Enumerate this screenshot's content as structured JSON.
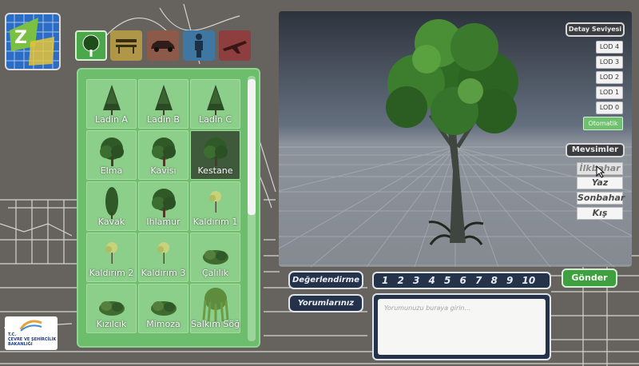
{
  "categories": [
    {
      "icon": "tree-icon",
      "active": true
    },
    {
      "icon": "bench-icon",
      "active": false
    },
    {
      "icon": "car-icon",
      "active": false
    },
    {
      "icon": "person-icon",
      "active": false
    },
    {
      "icon": "plane-icon",
      "active": false
    }
  ],
  "plants": [
    {
      "label": "Ladin A",
      "icon": "conifer-icon"
    },
    {
      "label": "Ladin B",
      "icon": "conifer-icon"
    },
    {
      "label": "Ladin C",
      "icon": "conifer-icon"
    },
    {
      "label": "Elma",
      "icon": "tree-icon"
    },
    {
      "label": "Kavisı",
      "icon": "tree-icon"
    },
    {
      "label": "Kestane",
      "icon": "tree-icon",
      "selected": true
    },
    {
      "label": "Kavak",
      "icon": "poplar-icon"
    },
    {
      "label": "Ihlamur",
      "icon": "tree-icon"
    },
    {
      "label": "Kaldırım 1",
      "icon": "sapling-icon"
    },
    {
      "label": "Kaldırım 2",
      "icon": "sapling-icon"
    },
    {
      "label": "Kaldırım 3",
      "icon": "sapling-icon"
    },
    {
      "label": "Çalılık",
      "icon": "shrub-icon"
    },
    {
      "label": "Kızılcık",
      "icon": "shrub-icon"
    },
    {
      "label": "Mimoza",
      "icon": "shrub-icon"
    },
    {
      "label": "Salkım Söğ",
      "icon": "willow-icon"
    }
  ],
  "ministry": {
    "line1": "T.C.",
    "line2": "ÇEVRE VE ŞEHİRCİLİK",
    "line3": "BAKANLIĞI"
  },
  "detail": {
    "title": "Detay Seviyesi",
    "levels": [
      "LOD 4",
      "LOD 3",
      "LOD 2",
      "LOD 1",
      "LOD 0"
    ],
    "auto": "Otomatik"
  },
  "seasons": {
    "title": "Mevsimler",
    "items": [
      "İlkbahar",
      "Yaz",
      "Sonbahar",
      "Kış"
    ]
  },
  "feedback": {
    "rating_label": "Değerlendirme",
    "comments_label": "Yorumlarınız",
    "ratings": [
      "1",
      "2",
      "3",
      "4",
      "5",
      "6",
      "7",
      "8",
      "9",
      "10"
    ],
    "send": "Gönder",
    "placeholder": "Yorumunuzu buraya girin..."
  },
  "colors": {
    "panel": "#6cbd6c",
    "accent": "#3fa03f",
    "dark_button": "#24324a"
  }
}
